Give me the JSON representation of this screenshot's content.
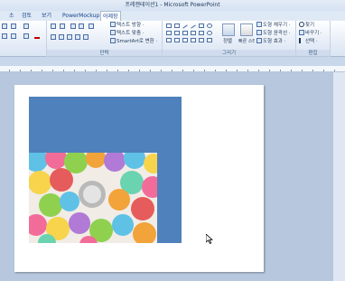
{
  "window": {
    "title": "프레젠테이션1 - Microsoft PowerPoint"
  },
  "tabs": [
    {
      "label": "소",
      "active": false
    },
    {
      "label": "검토",
      "active": false
    },
    {
      "label": "보기",
      "active": false
    },
    {
      "label": "PowerMockup",
      "active": false
    },
    {
      "label": "어제장",
      "active": true
    }
  ],
  "ribbon": {
    "paragraph": {
      "label": "단락",
      "text_direction": "텍스트 방향 ·",
      "text_align": "텍스트 맞춤 ·",
      "smartart": "SmartArt로 변환 ·"
    },
    "drawing": {
      "label": "그리기",
      "arrange": "정렬",
      "quick_styles": "빠른 스타일",
      "shape_fill": "도형 채우기 ·",
      "shape_outline": "도형 윤곽선 ·",
      "shape_effects": "도형 효과 ·"
    },
    "editing": {
      "label": "편집",
      "find": "찾기",
      "replace": "바꾸기 ·",
      "select": "선택 ·"
    }
  },
  "icons": [
    "find-icon",
    "replace-icon",
    "select-icon",
    "arrange-icon",
    "quick-styles-icon",
    "shape-fill-icon",
    "shape-outline-icon",
    "shape-effects-icon",
    "mouse-pointer-icon"
  ],
  "colors": {
    "slide_shape_fill": "#4f81bd",
    "ribbon_bg": "#dfe9f5",
    "workspace_bg": "#b7c8de"
  }
}
